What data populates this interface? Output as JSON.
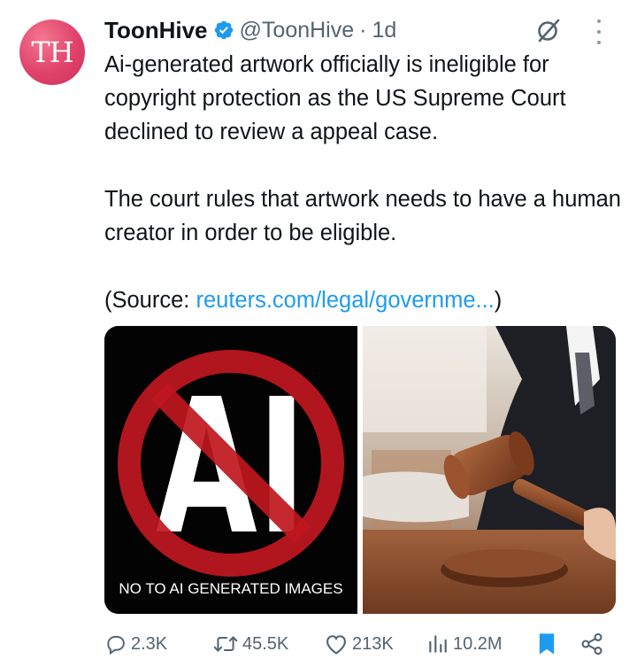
{
  "tweet": {
    "avatar_initials": "TH",
    "author_name": "ToonHive",
    "handle": "@ToonHive",
    "separator": "·",
    "time": "1d",
    "paragraphs": [
      "Ai-generated artwork officially is ineligible for copyright protection as the US Supreme Court declined to review a appeal case.",
      "The court rules that artwork needs to have a human creator in order to be eligible."
    ],
    "source_prefix": "(Source: ",
    "source_link": "reuters.com/legal/governme...",
    "source_suffix": ")",
    "media": {
      "left_caption": "NO TO AI GENERATED IMAGES",
      "left_logo_text": "AI"
    },
    "actions": {
      "replies": "2.3K",
      "retweets": "45.5K",
      "likes": "213K",
      "views": "10.2M"
    }
  },
  "colors": {
    "link": "#1d9bf0",
    "avatar": "#e0426a",
    "verified": "#1d9bf0",
    "bookmark_active": "#1d9bf0",
    "secondary_text": "#536471",
    "prohibition_red": "#c0171f"
  },
  "icons": [
    "verified-badge-icon",
    "grok-icon",
    "more-icon",
    "reply-icon",
    "retweet-icon",
    "like-icon",
    "views-icon",
    "bookmark-icon",
    "share-icon"
  ]
}
